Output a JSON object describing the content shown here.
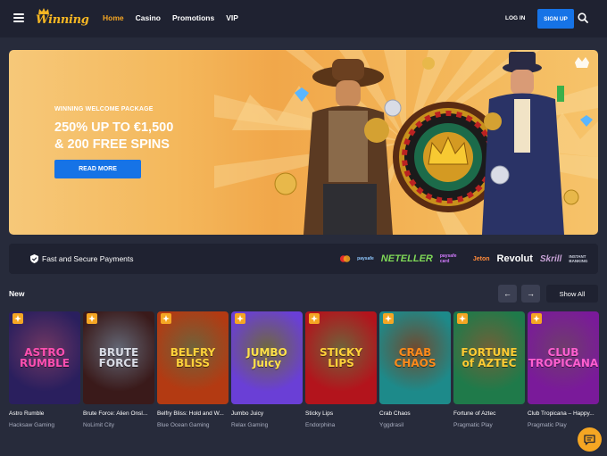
{
  "header": {
    "logo_text": "Winning",
    "nav": [
      "Home",
      "Casino",
      "Promotions",
      "VIP"
    ],
    "active_nav": "Home",
    "login_label": "LOG IN",
    "signup_label": "SIGN UP"
  },
  "hero": {
    "eyebrow": "WINNING WELCOME PACKAGE",
    "title_line1": "250% UP TO €1,500",
    "title_line2": "& 200 FREE SPINS",
    "button_label": "READ MORE"
  },
  "payments": {
    "label": "Fast and Secure Payments",
    "logos": [
      "mastercard",
      "paysafe",
      "NETELLER",
      "paysafe card",
      "Jeton",
      "Revolut",
      "Skrill",
      "INSTANT BANKING"
    ]
  },
  "new_section": {
    "title": "New",
    "show_all_label": "Show All",
    "prev_icon": "←",
    "next_icon": "→",
    "games": [
      {
        "name": "Astro Rumble",
        "provider": "Hacksaw Gaming",
        "art": "ASTRO RUMBLE",
        "bg": "#2a1f5e",
        "accent": "#ff4fb1"
      },
      {
        "name": "Brute Force: Alien Onsl...",
        "provider": "NoLimit City",
        "art": "BRUTE FORCE",
        "bg": "#3a1a1a",
        "accent": "#d9dce6"
      },
      {
        "name": "Belfry Bliss: Hold and W...",
        "provider": "Blue Ocean Gaming",
        "art": "BELFRY BLISS",
        "bg": "#b33a12",
        "accent": "#ffd23a"
      },
      {
        "name": "Jumbo Juicy",
        "provider": "Relax Gaming",
        "art": "JUMBO Juicy",
        "bg": "#6a3fd6",
        "accent": "#ffe14a"
      },
      {
        "name": "Sticky Lips",
        "provider": "Endorphina",
        "art": "STICKY LIPS",
        "bg": "#b3141c",
        "accent": "#ffd23a"
      },
      {
        "name": "Crab Chaos",
        "provider": "Yggdrasil",
        "art": "CRAB CHAOS",
        "bg": "#1d8a8a",
        "accent": "#ff8a1a"
      },
      {
        "name": "Fortune of Aztec",
        "provider": "Pragmatic Play",
        "art": "FORTUNE of AZTEC",
        "bg": "#1f7a4a",
        "accent": "#ffcc33"
      },
      {
        "name": "Club Tropicana – Happy...",
        "provider": "Pragmatic Play",
        "art": "CLUB TROPICANA",
        "bg": "#7a1a9a",
        "accent": "#ff5fd0"
      }
    ]
  }
}
